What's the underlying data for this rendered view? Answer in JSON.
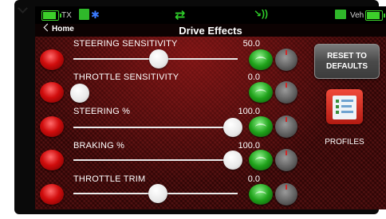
{
  "status_bar": {
    "tx_label": "TX",
    "veh_label": "Veh"
  },
  "header": {
    "home_label": "Home",
    "title": "Drive Effects"
  },
  "controls": [
    {
      "label": "STEERING SENSITIVITY",
      "value": "50.0",
      "level": 0.5
    },
    {
      "label": "THROTTLE SENSITIVITY",
      "value": "0.0",
      "level": 0.0
    },
    {
      "label": "STEERING %",
      "value": "100.0",
      "level": 1.0
    },
    {
      "label": "BRAKING %",
      "value": "100.0",
      "level": 1.0
    },
    {
      "label": "THROTTLE TRIM",
      "value": "0.0",
      "level": 0.5
    }
  ],
  "reset_button": {
    "line1": "RESET TO",
    "line2": "DEFAULTS"
  },
  "profiles": {
    "label": "PROFILES"
  },
  "colors": {
    "accent_green": "#2fd02a",
    "toggle_red": "#d10d0d",
    "background": "#4b0808"
  },
  "icons": [
    "battery-icon",
    "tx-icon",
    "bluetooth-icon",
    "direction-arrows-icon",
    "signal-icon",
    "vehicle-icon",
    "chevron-left-icon",
    "profiles-icon"
  ]
}
